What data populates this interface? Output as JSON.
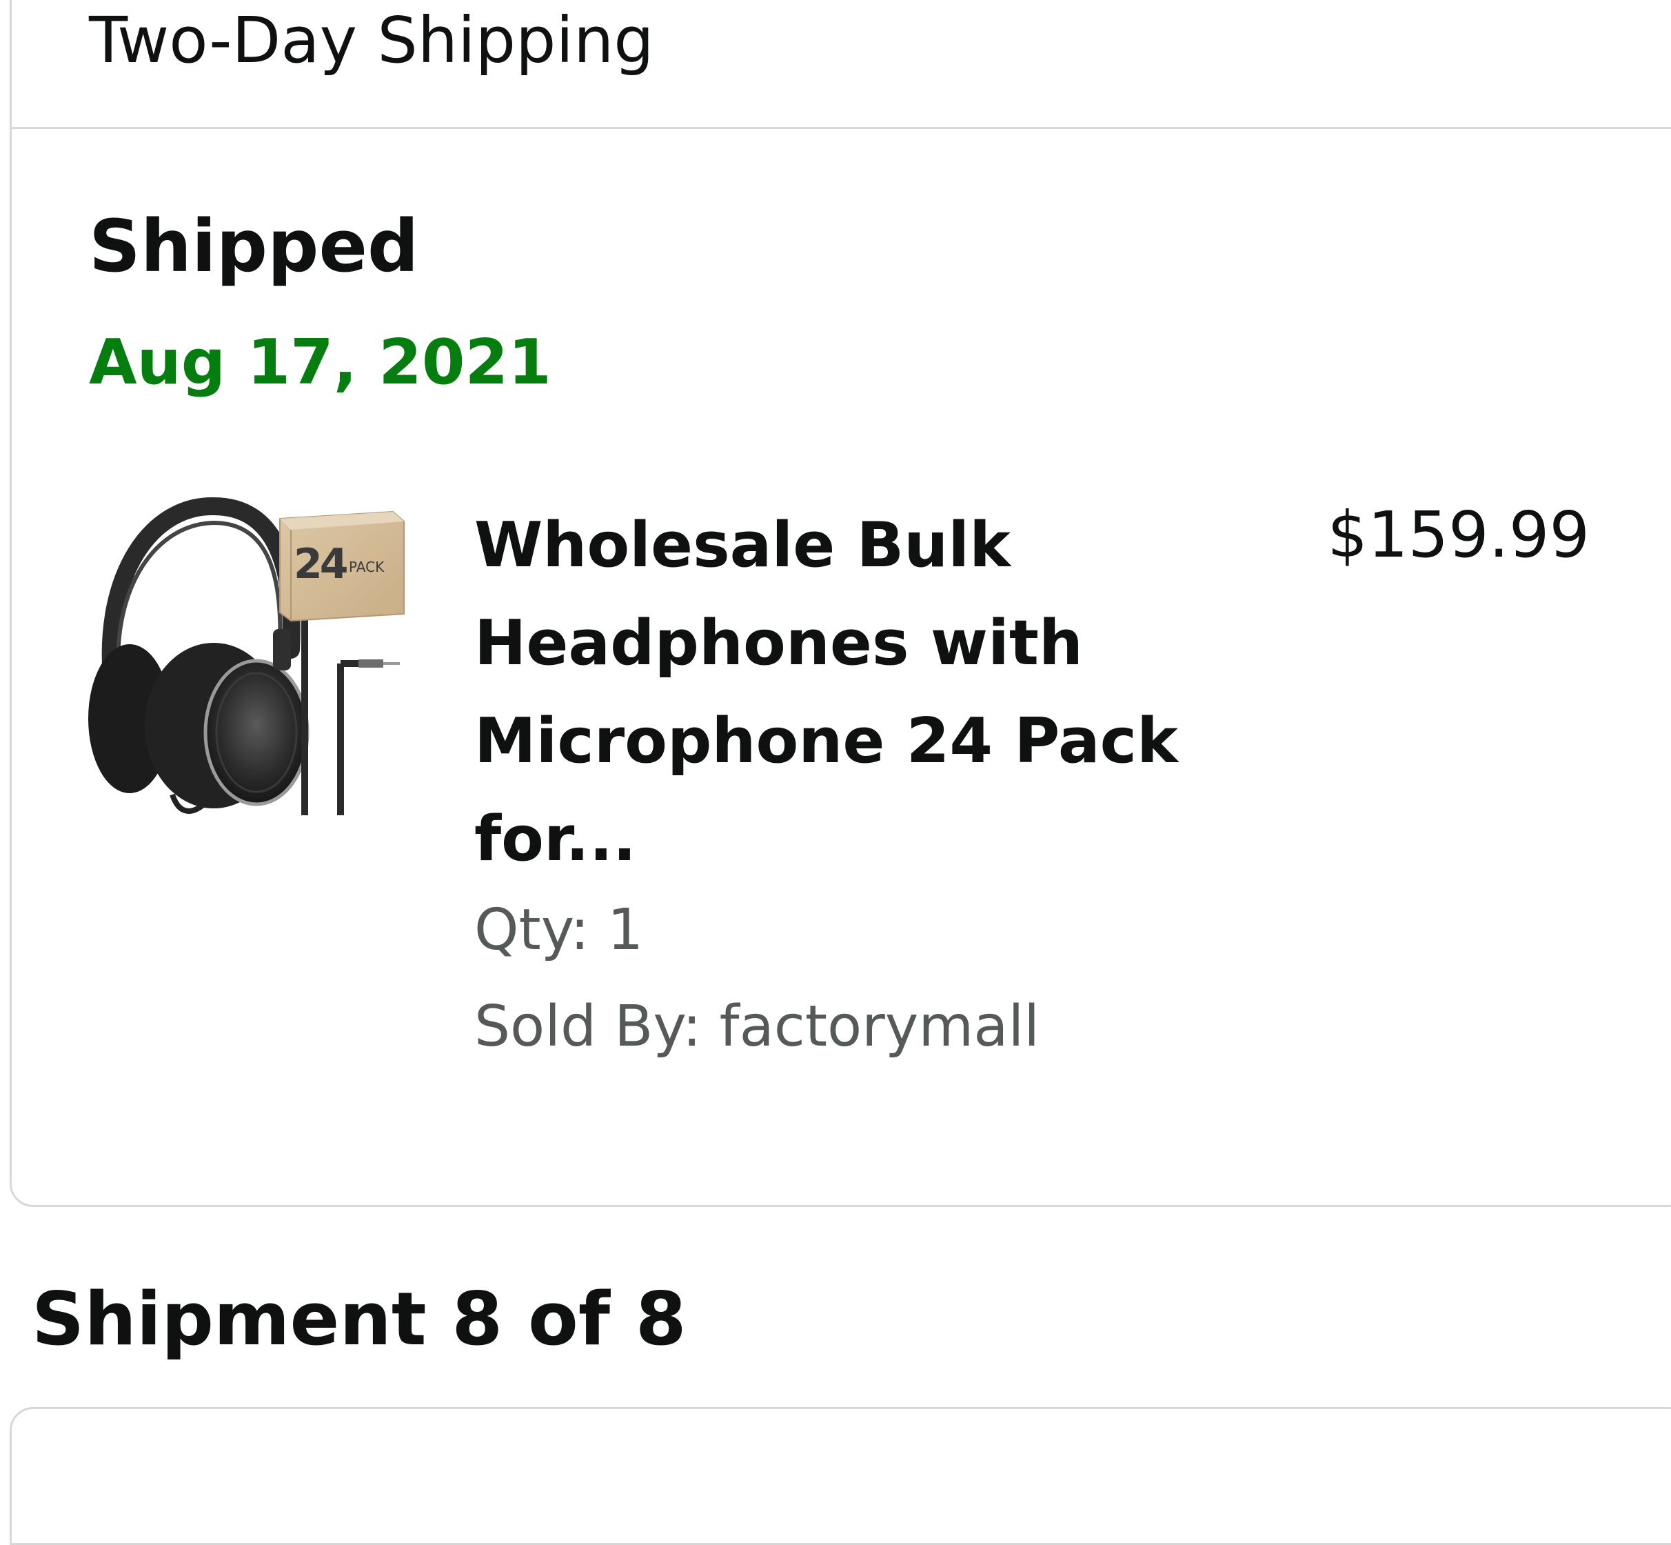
{
  "shipment_card": {
    "shipping_method": "Two-Day Shipping",
    "status": "Shipped",
    "status_date": "Aug 17, 2021",
    "colors": {
      "status_date": "#067d0f",
      "border": "#d5d9d9",
      "secondary_text": "#565959"
    },
    "item": {
      "image_icon": "headphones-product-image",
      "box_badge": "24",
      "box_badge_small": "PACK",
      "title": "Wholesale Bulk Headphones with Microphone 24 Pack for...",
      "price": "$159.99",
      "qty": "Qty: 1",
      "sold_by": "Sold By: factorymall"
    }
  },
  "next_shipment": {
    "heading": "Shipment 8 of 8"
  }
}
